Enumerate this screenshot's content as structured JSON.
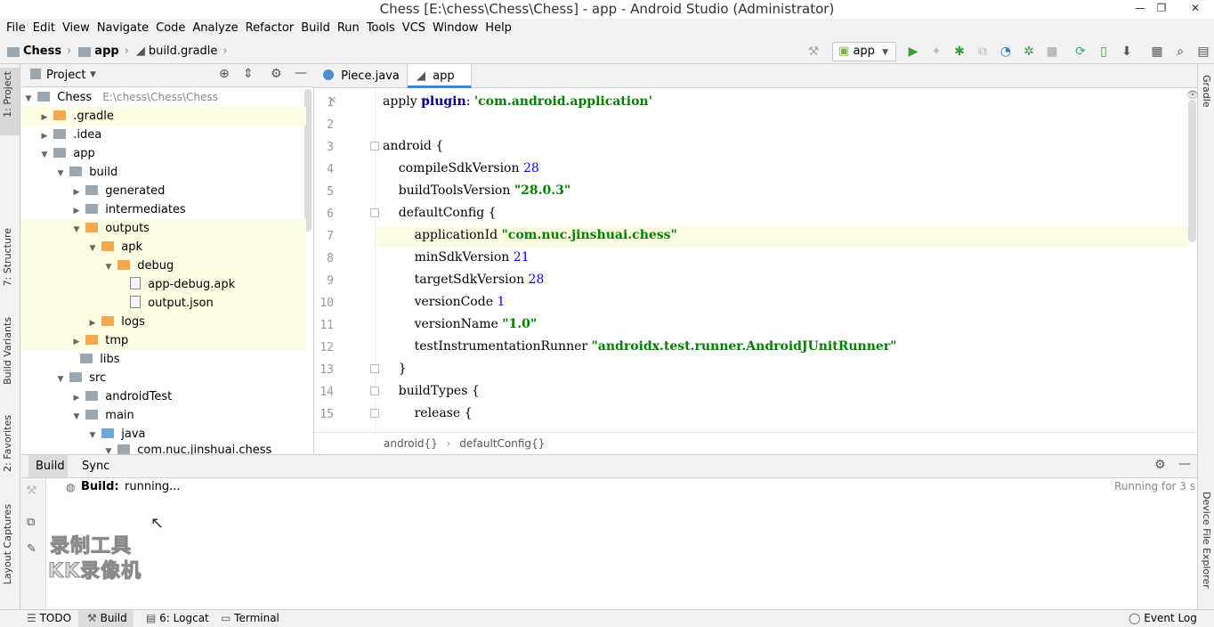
{
  "window": {
    "title": "Chess [E:\\chess\\Chess\\Chess] - app - Android Studio (Administrator)",
    "minimize": "—",
    "restore": "❐",
    "close": "✕"
  },
  "menu": [
    "File",
    "Edit",
    "View",
    "Navigate",
    "Code",
    "Analyze",
    "Refactor",
    "Build",
    "Run",
    "Tools",
    "VCS",
    "Window",
    "Help"
  ],
  "breadcrumb": {
    "project": "Chess",
    "module": "app",
    "file": "build.gradle"
  },
  "toolbar": {
    "run_config": "app"
  },
  "left_tabs": {
    "project": "1: Project",
    "structure": "7: Structure",
    "build_variants": "Build Variants",
    "favorites": "2: Favorites",
    "layout_captures": "Layout Captures"
  },
  "right_tabs": {
    "gradle": "Gradle",
    "device_file_explorer": "Device File Explorer"
  },
  "project_panel": {
    "title": "Project",
    "tree": [
      {
        "label": "Chess",
        "extra": "E:\\chess\\Chess\\Chess"
      },
      {
        "label": ".gradle"
      },
      {
        "label": ".idea"
      },
      {
        "label": "app"
      },
      {
        "label": "build"
      },
      {
        "label": "generated"
      },
      {
        "label": "intermediates"
      },
      {
        "label": "outputs"
      },
      {
        "label": "apk"
      },
      {
        "label": "debug"
      },
      {
        "label": "app-debug.apk"
      },
      {
        "label": "output.json"
      },
      {
        "label": "logs"
      },
      {
        "label": "tmp"
      },
      {
        "label": "libs"
      },
      {
        "label": "src"
      },
      {
        "label": "androidTest"
      },
      {
        "label": "main"
      },
      {
        "label": "java"
      },
      {
        "label": "com.nuc.jinshuai.chess"
      }
    ]
  },
  "editor": {
    "tabs": [
      {
        "label": "Piece.java"
      },
      {
        "label": "app"
      }
    ],
    "lines": [
      {
        "n": "1",
        "pre": "apply ",
        "kw": "plugin",
        "mid": ": ",
        "str": "'com.android.application'",
        "num": "",
        "post": ""
      },
      {
        "n": "2",
        "pre": "",
        "kw": "",
        "mid": "",
        "str": "",
        "num": "",
        "post": ""
      },
      {
        "n": "3",
        "pre": "android {",
        "kw": "",
        "mid": "",
        "str": "",
        "num": "",
        "post": ""
      },
      {
        "n": "4",
        "pre": "    compileSdkVersion ",
        "kw": "",
        "mid": "",
        "str": "",
        "num": "28",
        "post": ""
      },
      {
        "n": "5",
        "pre": "    buildToolsVersion ",
        "kw": "",
        "mid": "",
        "str": "\"28.0.3\"",
        "num": "",
        "post": ""
      },
      {
        "n": "6",
        "pre": "    defaultConfig {",
        "kw": "",
        "mid": "",
        "str": "",
        "num": "",
        "post": ""
      },
      {
        "n": "7",
        "pre": "        applicationId ",
        "kw": "",
        "mid": "",
        "str": "\"com.nuc.jinshuai.chess\"",
        "num": "",
        "post": ""
      },
      {
        "n": "8",
        "pre": "        minSdkVersion ",
        "kw": "",
        "mid": "",
        "str": "",
        "num": "21",
        "post": ""
      },
      {
        "n": "9",
        "pre": "        targetSdkVersion ",
        "kw": "",
        "mid": "",
        "str": "",
        "num": "28",
        "post": ""
      },
      {
        "n": "10",
        "pre": "        versionCode ",
        "kw": "",
        "mid": "",
        "str": "",
        "num": "1",
        "post": ""
      },
      {
        "n": "11",
        "pre": "        versionName ",
        "kw": "",
        "mid": "",
        "str": "\"1.0\"",
        "num": "",
        "post": ""
      },
      {
        "n": "12",
        "pre": "        testInstrumentationRunner ",
        "kw": "",
        "mid": "",
        "str": "\"androidx.test.runner.AndroidJUnitRunner\"",
        "num": "",
        "post": ""
      },
      {
        "n": "13",
        "pre": "    }",
        "kw": "",
        "mid": "",
        "str": "",
        "num": "",
        "post": ""
      },
      {
        "n": "14",
        "pre": "    buildTypes {",
        "kw": "",
        "mid": "",
        "str": "",
        "num": "",
        "post": ""
      },
      {
        "n": "15",
        "pre": "        release {",
        "kw": "",
        "mid": "",
        "str": "",
        "num": "",
        "post": ""
      }
    ],
    "breadcrumb": [
      "android{}",
      "defaultConfig{}"
    ]
  },
  "build_panel": {
    "tabs": [
      "Build",
      "Sync"
    ],
    "status_label": "Build:",
    "status_value": "running...",
    "elapsed": "Running for 3 s"
  },
  "watermark": {
    "line1": "录制工具",
    "line2": "KK录像机"
  },
  "bottom_tabs": {
    "todo": "TODO",
    "build": "Build",
    "logcat": "6: Logcat",
    "terminal": "Terminal",
    "event_log": "Event Log"
  }
}
